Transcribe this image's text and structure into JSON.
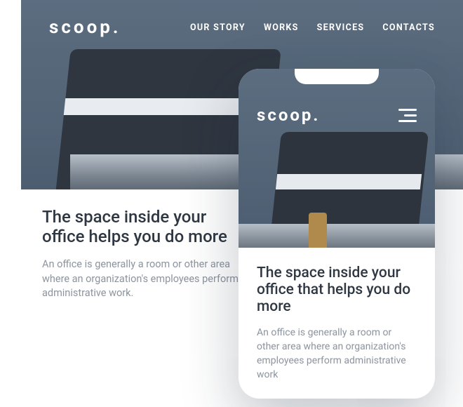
{
  "brand": "scoop.",
  "nav": {
    "items": [
      {
        "label": "OUR STORY"
      },
      {
        "label": "WORKS"
      },
      {
        "label": "SERVICES"
      },
      {
        "label": "CONTACTS"
      }
    ]
  },
  "desktop": {
    "heading": "The space inside your office helps you do more",
    "body": "An office is generally a room or other area where an organization's employees perform administrative work."
  },
  "mobile": {
    "heading": "The space inside your office that helps you do more",
    "body": "An office is generally a room or other area where an organization's employees perform administrative work"
  }
}
